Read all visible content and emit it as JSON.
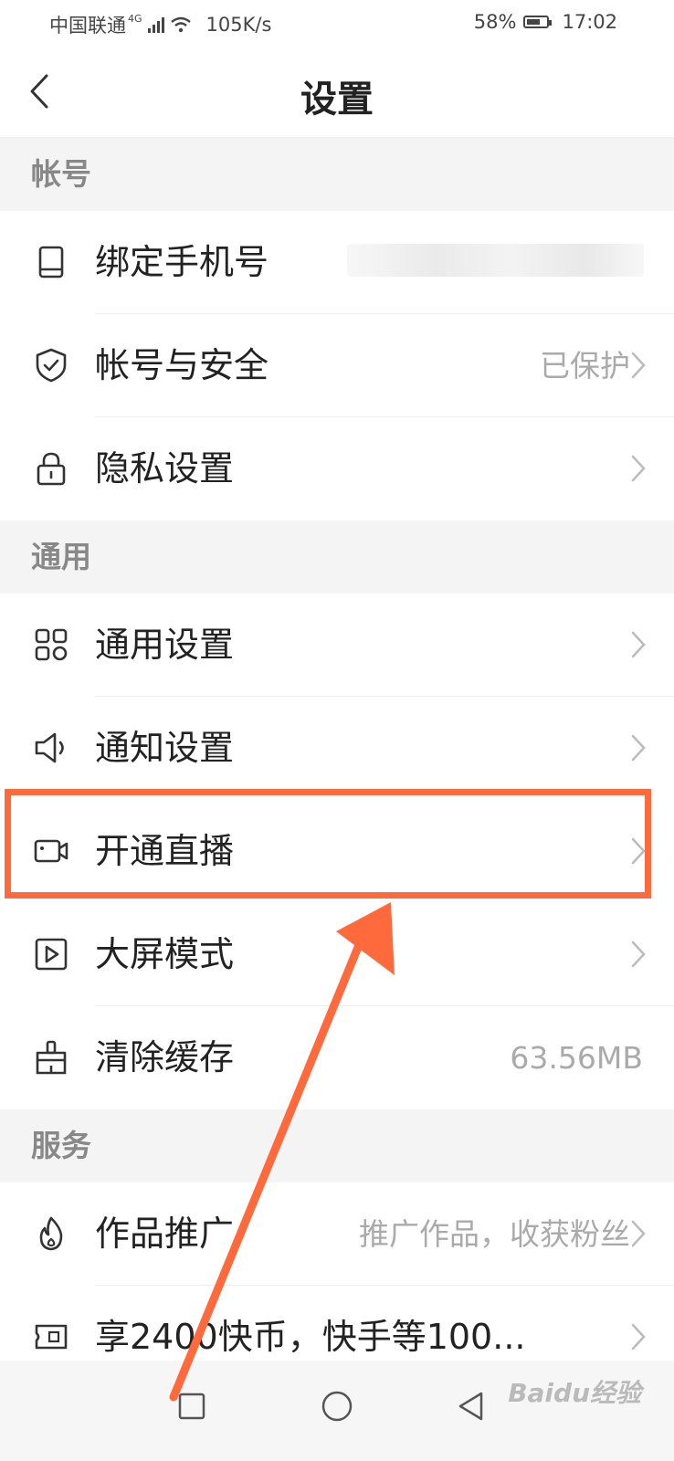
{
  "status_bar": {
    "carrier": "中国联通",
    "network": "4G",
    "speed": "105K/s",
    "battery": "58%",
    "time": "17:02"
  },
  "header": {
    "title": "设置",
    "back_icon": "chevron-left-icon"
  },
  "sections": {
    "account": {
      "title": "帐号",
      "items": [
        {
          "label": "绑定手机号",
          "value": "",
          "icon": "phone-icon"
        },
        {
          "label": "帐号与安全",
          "value": "已保护",
          "icon": "shield-check-icon"
        },
        {
          "label": "隐私设置",
          "value": "",
          "icon": "lock-icon"
        }
      ]
    },
    "general": {
      "title": "通用",
      "items": [
        {
          "label": "通用设置",
          "value": "",
          "icon": "grid-icon"
        },
        {
          "label": "通知设置",
          "value": "",
          "icon": "speaker-icon"
        },
        {
          "label": "开通直播",
          "value": "",
          "icon": "video-camera-icon"
        },
        {
          "label": "大屏模式",
          "value": "",
          "icon": "play-icon"
        },
        {
          "label": "清除缓存",
          "value": "63.56MB",
          "icon": "broom-icon"
        }
      ]
    },
    "service": {
      "title": "服务",
      "items": [
        {
          "label": "作品推广",
          "value": "推广作品，收获粉丝",
          "icon": "flame-icon"
        },
        {
          "label": "享2400快币，快手等100...",
          "value": "",
          "icon": "ticket-icon"
        }
      ]
    }
  },
  "annotation": {
    "highlight_color": "#ff6a3d",
    "arrow_color": "#ff6a3d"
  },
  "watermark": "Baidu经验"
}
